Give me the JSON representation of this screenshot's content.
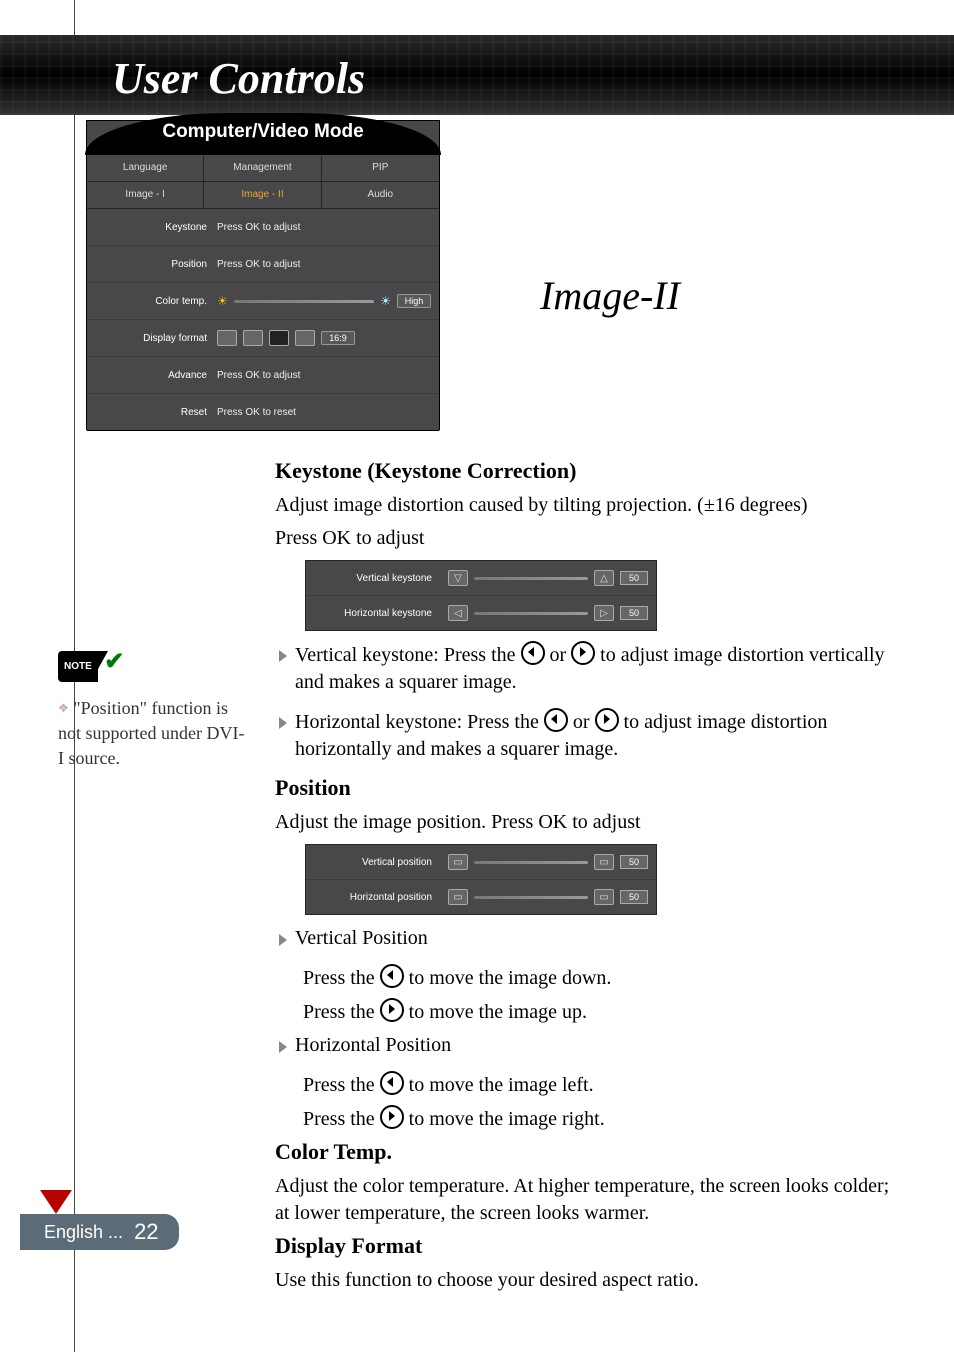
{
  "banner_title": "User Controls",
  "osd_header": "Computer/Video Mode",
  "osd_tabs_row1": [
    "Language",
    "Management",
    "PIP"
  ],
  "osd_tabs_row2": [
    "Image - I",
    "Image - II",
    "Audio"
  ],
  "osd_items": {
    "keystone": {
      "label": "Keystone",
      "value": "Press OK to adjust"
    },
    "position": {
      "label": "Position",
      "value": "Press OK to adjust"
    },
    "color_temp": {
      "label": "Color temp.",
      "chip": "High"
    },
    "display_format": {
      "label": "Display format",
      "chip": "16:9"
    },
    "advance": {
      "label": "Advance",
      "value": "Press OK to adjust"
    },
    "reset": {
      "label": "Reset",
      "value": "Press OK to reset"
    }
  },
  "section_title": "Image-II",
  "note_tag": "NOTE",
  "note_text": "\"Position\" function is not supported under DVI-I source.",
  "keystone_h": "Keystone (Keystone Correction)",
  "keystone_p1": "Adjust image distortion caused by tilting projection. (±16 degrees)",
  "keystone_p2": "Press OK to adjust",
  "keystone_panel": {
    "v_label": "Vertical keystone",
    "v_val": "50",
    "h_label": "Horizontal keystone",
    "h_val": "50"
  },
  "keystone_b1a": "Vertical keystone: Press the ",
  "keystone_b1b": " or ",
  "keystone_b1c": " to adjust image distortion vertically and makes a squarer image.",
  "keystone_b2a": "Horizontal keystone: Press the ",
  "keystone_b2b": " or ",
  "keystone_b2c": " to adjust image distortion horizontally and makes a squarer image.",
  "position_h": "Position",
  "position_p": "Adjust the image position. Press OK to adjust",
  "position_panel": {
    "v_label": "Vertical position",
    "v_val": "50",
    "h_label": "Horizontal position",
    "h_val": "50"
  },
  "pos_b1": "Vertical Position",
  "pos_b1_l1a": "Press the ",
  "pos_b1_l1b": " to move the image down.",
  "pos_b1_l2a": "Press the ",
  "pos_b1_l2b": " to move the image up.",
  "pos_b2": "Horizontal Position",
  "pos_b2_l1a": "Press the ",
  "pos_b2_l1b": " to move the image left.",
  "pos_b2_l2a": "Press the ",
  "pos_b2_l2b": " to move the image right.",
  "colortemp_h": "Color Temp.",
  "colortemp_p": "Adjust the color temperature. At higher temperature, the screen looks colder; at lower temperature, the screen looks warmer.",
  "dispfmt_h": "Display Format",
  "dispfmt_p": "Use this function to choose your desired aspect ratio.",
  "footer_lang": "English ...",
  "footer_page": "22"
}
